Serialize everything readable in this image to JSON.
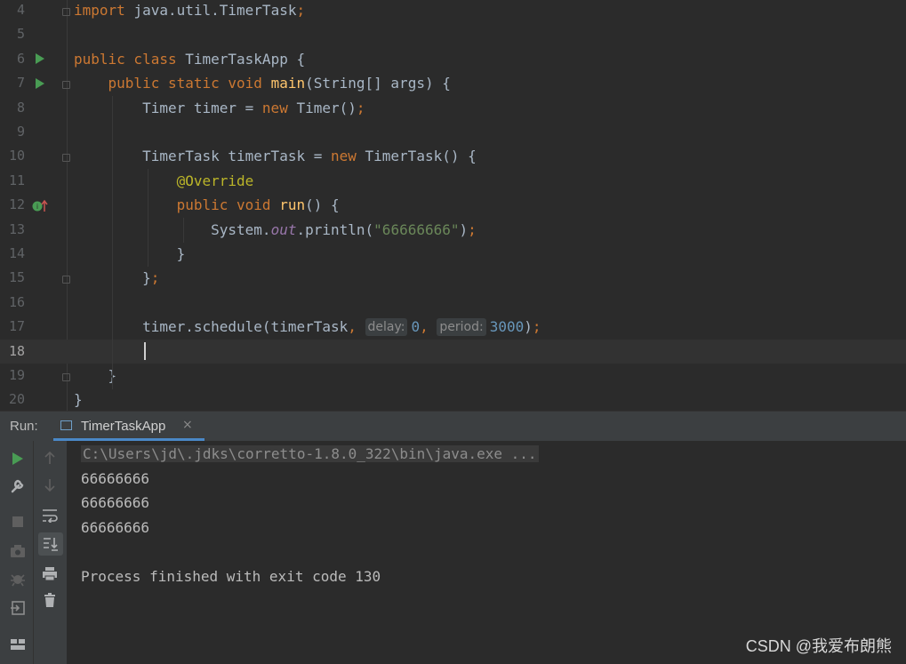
{
  "editor": {
    "lines": [
      {
        "num": "4",
        "parts": [
          [
            "kw",
            "import "
          ],
          [
            "",
            "java.util.TimerTask"
          ],
          [
            "kw",
            ";"
          ]
        ]
      },
      {
        "num": "5",
        "parts": []
      },
      {
        "num": "6",
        "parts": [
          [
            "kw",
            "public class "
          ],
          [
            "",
            "TimerTaskApp {"
          ]
        ]
      },
      {
        "num": "7",
        "parts": [
          [
            "",
            "    "
          ],
          [
            "kw",
            "public static void "
          ],
          [
            "fn",
            "main"
          ],
          [
            "",
            "(String[] args) {"
          ]
        ]
      },
      {
        "num": "8",
        "parts": [
          [
            "",
            "        Timer timer = "
          ],
          [
            "kw",
            "new "
          ],
          [
            "",
            "Timer()"
          ],
          [
            "kw",
            ";"
          ]
        ]
      },
      {
        "num": "9",
        "parts": []
      },
      {
        "num": "10",
        "parts": [
          [
            "",
            "        TimerTask timerTask = "
          ],
          [
            "kw",
            "new "
          ],
          [
            "",
            "TimerTask() {"
          ]
        ]
      },
      {
        "num": "11",
        "parts": [
          [
            "",
            "            "
          ],
          [
            "ann",
            "@Override"
          ]
        ]
      },
      {
        "num": "12",
        "parts": [
          [
            "",
            "            "
          ],
          [
            "kw",
            "public void "
          ],
          [
            "fn",
            "run"
          ],
          [
            "",
            "() {"
          ]
        ]
      },
      {
        "num": "13",
        "parts": [
          [
            "",
            "                System."
          ],
          [
            "fld",
            "out"
          ],
          [
            "",
            ".println("
          ],
          [
            "str",
            "\"66666666\""
          ],
          [
            "",
            ")"
          ],
          [
            "kw",
            ";"
          ]
        ]
      },
      {
        "num": "14",
        "parts": [
          [
            "",
            "            }"
          ]
        ]
      },
      {
        "num": "15",
        "parts": [
          [
            "",
            "        }"
          ],
          [
            "kw",
            ";"
          ]
        ]
      },
      {
        "num": "16",
        "parts": []
      },
      {
        "num": "17",
        "parts": [
          [
            "",
            "        timer.schedule(timerTask"
          ],
          [
            "kw",
            ", "
          ],
          [
            "hint",
            "delay:"
          ],
          [
            "num",
            "0"
          ],
          [
            "kw",
            ", "
          ],
          [
            "hint",
            "period:"
          ],
          [
            "num",
            "3000"
          ],
          [
            "",
            ")"
          ],
          [
            "kw",
            ";"
          ]
        ]
      },
      {
        "num": "18",
        "parts": []
      },
      {
        "num": "19",
        "parts": [
          [
            "",
            "    }"
          ]
        ]
      },
      {
        "num": "20",
        "parts": [
          [
            "",
            "}"
          ]
        ]
      }
    ]
  },
  "run_panel": {
    "label": "Run:",
    "tab_label": "TimerTaskApp",
    "tab_close": "×"
  },
  "console": {
    "command": "C:\\Users\\jd\\.jdks\\corretto-1.8.0_322\\bin\\java.exe ...",
    "outputs": [
      "66666666",
      "66666666",
      "66666666"
    ],
    "exit_message": "Process finished with exit code 130"
  },
  "watermark": "CSDN @我爱布朗熊",
  "colors": {
    "background": "#2b2b2b",
    "keyword": "#cc7832",
    "function": "#ffc66d",
    "string": "#6a8759",
    "number": "#6897bb",
    "annotation": "#bbb529",
    "run_green": "#499c54",
    "tab_underline": "#4a88c7"
  }
}
